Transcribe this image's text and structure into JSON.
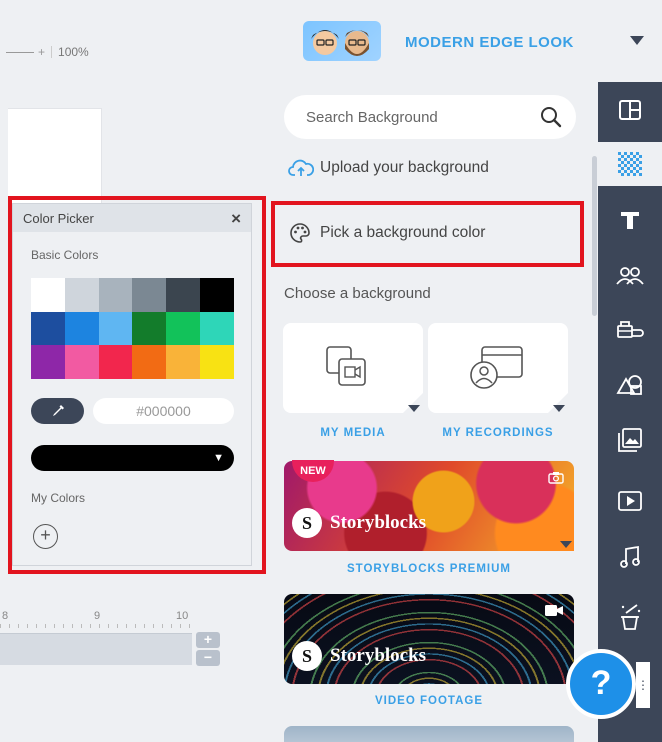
{
  "canvas": {
    "zoom_level": "100%",
    "zoom_plus": "+",
    "ruler_labels": [
      "8",
      "9",
      "10"
    ],
    "zoom_in": "+",
    "zoom_out": "−"
  },
  "color_picker": {
    "title": "Color Picker",
    "close_glyph": "×",
    "basic_colors_label": "Basic Colors",
    "basic_colors": [
      "#ffffff",
      "#cfd5dc",
      "#a8b3bd",
      "#7b8893",
      "#3b454f",
      "#000000",
      "#1d4e9f",
      "#1d84e0",
      "#5fb6f2",
      "#137c2b",
      "#12c25a",
      "#2ed6b8",
      "#8e27a8",
      "#f25aa2",
      "#f2264d",
      "#f26b14",
      "#f9b339",
      "#f8e213"
    ],
    "hex_placeholder": "#000000",
    "selected_color": "#000000",
    "my_colors_label": "My Colors",
    "add_glyph": "+"
  },
  "header": {
    "project_title": "MODERN EDGE LOOK"
  },
  "background_panel": {
    "search_placeholder": "Search Background",
    "upload_label": "Upload your background",
    "pick_color_label": "Pick a background color",
    "choose_label": "Choose a background",
    "tiles": [
      {
        "label": "MY MEDIA"
      },
      {
        "label": "MY RECORDINGS"
      }
    ],
    "cards": [
      {
        "badge": "NEW",
        "brand": "Storyblocks",
        "brand_initial": "S",
        "label": "STORYBLOCKS PREMIUM"
      },
      {
        "brand": "Storyblocks",
        "brand_initial": "S",
        "label": "VIDEO FOOTAGE"
      }
    ]
  },
  "help": {
    "glyph": "?",
    "dots": "⋮"
  },
  "colors": {
    "accent": "#3aa0e6",
    "rail": "#3c4658",
    "highlight": "#e2141e",
    "help": "#1e90e8"
  }
}
